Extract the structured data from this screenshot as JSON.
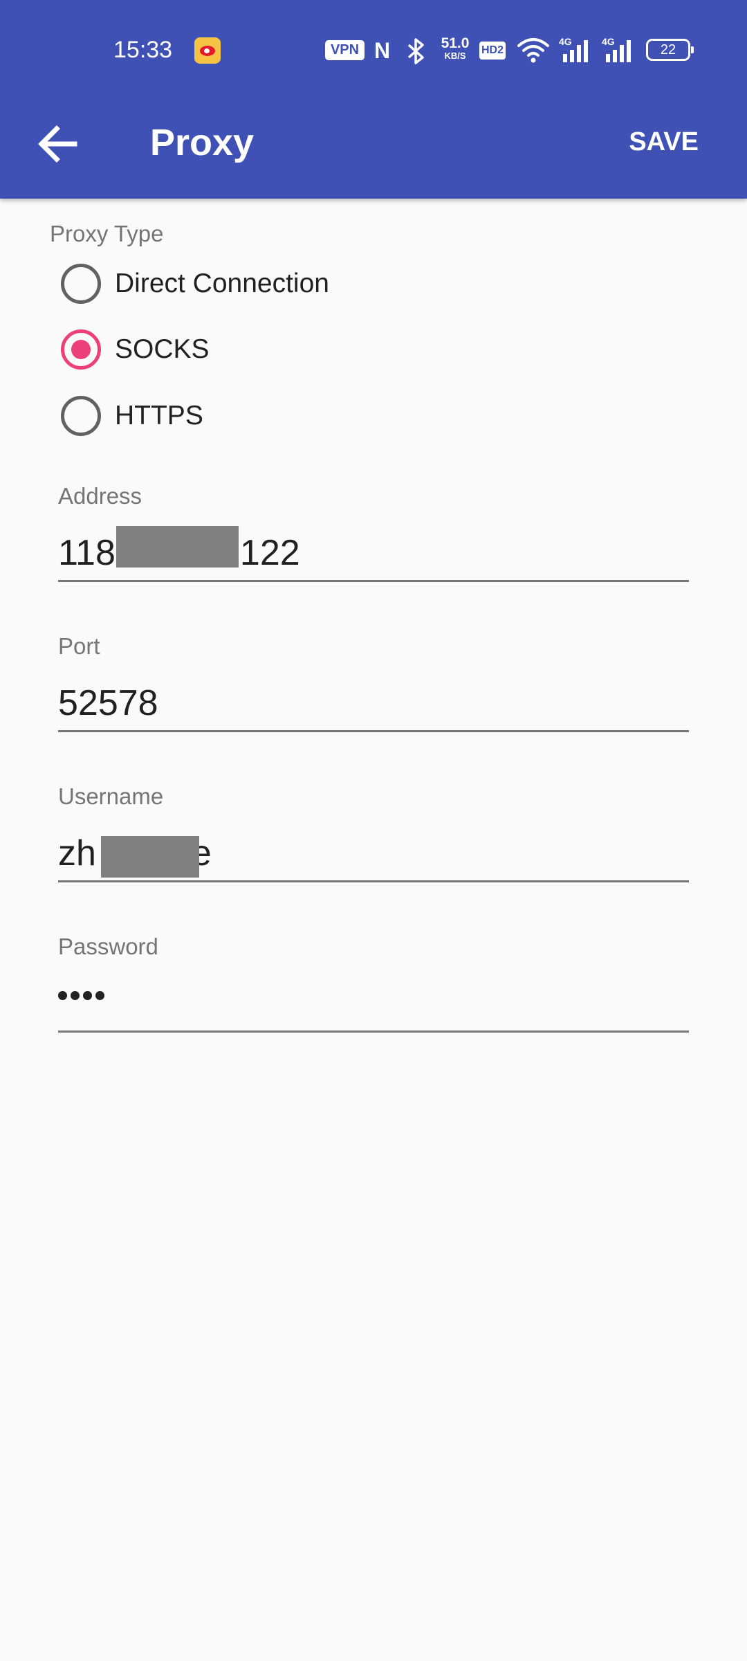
{
  "status_bar": {
    "time": "15:33",
    "vpn": "VPN",
    "nfc": "N",
    "net_speed_value": "51.0",
    "net_speed_unit": "KB/S",
    "hd": "HD2",
    "signal_label_1": "4G",
    "signal_label_2": "4G",
    "battery": "22",
    "icons": [
      "weibo-icon",
      "vpn-icon",
      "nfc-icon",
      "bluetooth-icon",
      "hd-icon",
      "wifi-icon",
      "signal-icon",
      "signal-icon",
      "battery-icon"
    ]
  },
  "toolbar": {
    "title": "Proxy",
    "save_label": "SAVE",
    "back_icon": "arrow-left-icon"
  },
  "form": {
    "proxy_type_label": "Proxy Type",
    "options": [
      {
        "label": "Direct Connection",
        "checked": false
      },
      {
        "label": "SOCKS",
        "checked": true
      },
      {
        "label": "HTTPS",
        "checked": false
      }
    ],
    "address": {
      "label": "Address",
      "value_start": "118",
      "value_end": "122"
    },
    "port": {
      "label": "Port",
      "value": "52578"
    },
    "username": {
      "label": "Username",
      "value_start": "zh",
      "value_end": "e"
    },
    "password": {
      "label": "Password",
      "masked_length": 4
    }
  },
  "colors": {
    "primary": "#3f51b5",
    "accent": "#ec407a",
    "background": "#fafafa"
  }
}
